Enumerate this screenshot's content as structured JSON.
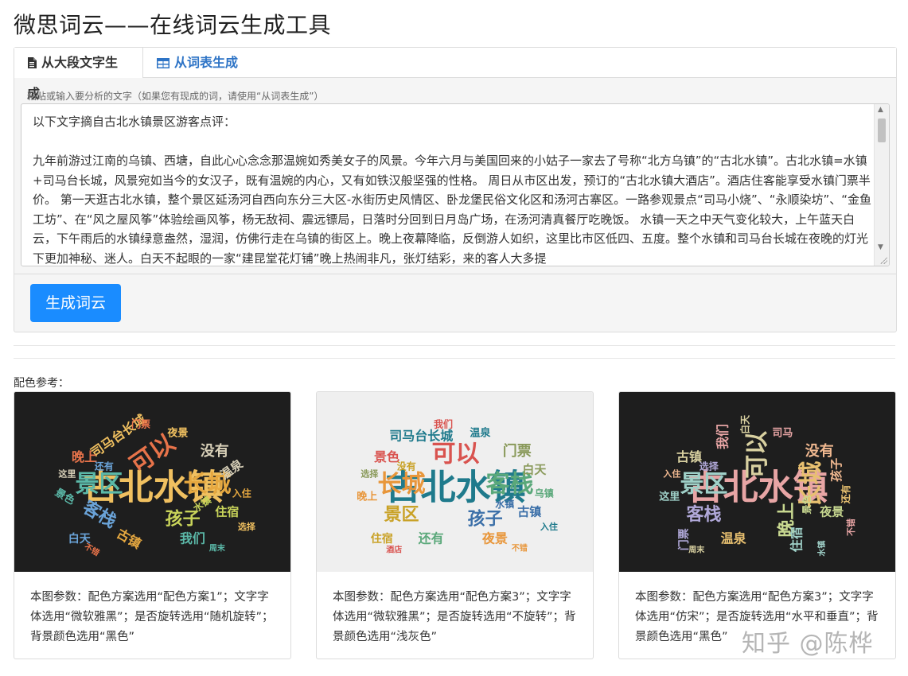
{
  "page": {
    "title": "微思词云——在线词云生成工具"
  },
  "tabs": [
    {
      "label": "从大段文字生成"
    },
    {
      "label": "从词表生成"
    }
  ],
  "input": {
    "hint": "粘贴或输入要分析的文字（如果您有现成的词，请使用“从词表生成”）",
    "line1": "以下文字摘自古北水镇景区游客点评：",
    "body": "九年前游过江南的乌镇、西塘，自此心心念念那温婉如秀美女子的风景。今年六月与美国回来的小姑子一家去了号称“北方乌镇”的“古北水镇”。古北水镇=水镇+司马台长城，风景宛如当今的女汉子，既有温婉的内心，又有如铁汉般坚强的性格。 周日从市区出发，预订的“古北水镇大酒店”。酒店住客能享受水镇门票半价。 第一天逛古北水镇，整个景区延汤河自西向东分三大区-水街历史风情区、卧龙堡民俗文化区和汤河古寨区。一路参观景点“司马小烧”、“永顺染坊”、“金鱼工坊”、在“风之屋风筝”体验绘画风筝，杨无敌祠、震远镖局，日落时分回到日月岛广场，在汤河清真餐厅吃晚饭。 水镇一天之中天气变化较大，上午蓝天白云，下午雨后的水镇绿意盎然，湿润，仿佛行走在乌镇的街区上。晚上夜幕降临，反倒游人如织，这里比市区低四、五度。整个水镇和司马台长城在夜晚的灯光下更加神秘、迷人。白天不起眼的一家“建昆堂花灯铺”晚上热闹非凡，张灯结彩，来的客人大多提"
  },
  "generate_button": {
    "label": "生成词云"
  },
  "palette_ref": {
    "label": "配色参考："
  },
  "cards": [
    {
      "caption": "本图参数：配色方案选用“配色方案1”；文字字体选用“微软雅黑”；是否旋转选用“随机旋转”；背景颜色选用“黑色”",
      "background": "#1e1e1e"
    },
    {
      "caption": "本图参数：配色方案选用“配色方案3”；文字字体选用“微软雅黑”；是否旋转选用“不旋转”；背景颜色选用“浅灰色”",
      "background": "#efefef"
    },
    {
      "caption": "本图参数：配色方案选用“配色方案3”；文字字体选用“仿宋”；是否旋转选用“水平和垂直”；背景颜色选用“黑色”",
      "background": "#1e1e1e"
    }
  ],
  "clouds": [
    {
      "words": [
        "古北水镇",
        "可以",
        "景区",
        "长城",
        "客栈",
        "孩子",
        "没有",
        "司马台长城",
        "晚上",
        "我们",
        "古镇",
        "白天",
        "住宿",
        "温泉",
        "夜景",
        "门票",
        "景色",
        "入住",
        "还有",
        "水镇",
        "这里",
        "选择",
        "不错",
        "周末"
      ],
      "colors": [
        "#f0c060",
        "#e8734a",
        "#5bb8a8",
        "#e6a840",
        "#6aa3d8",
        "#c9d45a",
        "#d8d0b8"
      ]
    },
    {
      "words": [
        "古北水镇",
        "可以",
        "长城",
        "客栈",
        "景区",
        "孩子",
        "门票",
        "司马台长城",
        "景色",
        "夜景",
        "还有",
        "住宿",
        "古镇",
        "白天",
        "温泉",
        "我们",
        "晚上",
        "乌镇",
        "没有",
        "水镇",
        "选择",
        "入住",
        "酒店",
        "不错"
      ],
      "colors": [
        "#1f7a8c",
        "#d9534f",
        "#e8963a",
        "#5aa87a",
        "#c9a227",
        "#3b6fa8",
        "#8a9a5b"
      ]
    },
    {
      "words": [
        "古北水镇",
        "可以",
        "景区",
        "长城",
        "客栈",
        "晚上",
        "没有",
        "我们",
        "古镇",
        "住宿",
        "温泉",
        "门票",
        "夜景",
        "孩子",
        "司马",
        "白天",
        "这里",
        "还有",
        "选择",
        "景色",
        "入住",
        "不错",
        "周末",
        "水镇"
      ],
      "colors": [
        "#e8a5a5",
        "#d8d0a0",
        "#9fd0c8",
        "#e8c070",
        "#b0a8d8",
        "#c8d890",
        "#f0b890"
      ]
    }
  ],
  "watermark": {
    "text": "知乎 @陈桦"
  }
}
